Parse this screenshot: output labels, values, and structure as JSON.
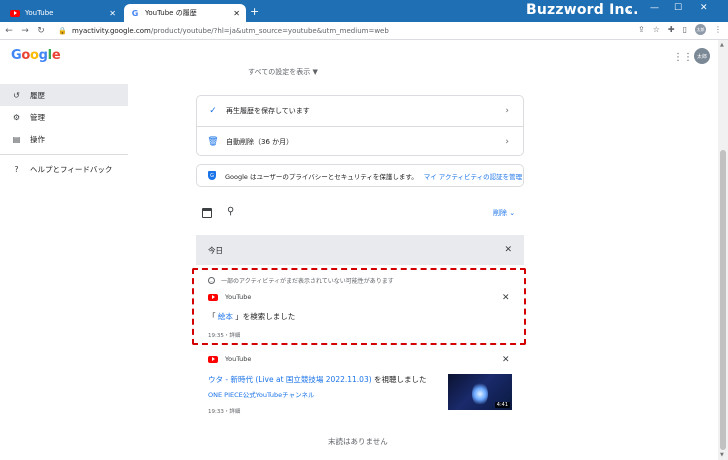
{
  "browser": {
    "tabs": [
      {
        "title": "YouTube",
        "active": false
      },
      {
        "title": "YouTube の履歴",
        "active": true
      }
    ],
    "new_tab": "+",
    "brand": "Buzzword Inc.",
    "url_host": "myactivity.google.com",
    "url_path": "/product/youtube/?hl=ja&utm_source=youtube&utm_medium=web",
    "profile_avatar": "太郎"
  },
  "header": {
    "logo_letters": [
      "G",
      "o",
      "o",
      "g",
      "l",
      "e"
    ],
    "account_avatar": "太郎"
  },
  "sidebar": {
    "items": [
      {
        "label": "履歴",
        "icon": "history-icon",
        "selected": true
      },
      {
        "label": "管理",
        "icon": "gear-icon",
        "selected": false
      },
      {
        "label": "操作",
        "icon": "feedback-icon",
        "selected": false
      },
      {
        "label": "ヘルプとフィードバック",
        "icon": "help-icon",
        "selected": false
      }
    ]
  },
  "main": {
    "cut_text": "すべての設定を表示 ▼",
    "settings": [
      {
        "label": "再生履歴を保存しています",
        "icon": "check-circle-icon"
      },
      {
        "label": "自動削除（36 か月）",
        "icon": "auto-delete-icon"
      }
    ],
    "privacy": {
      "text": "Google はユーザーのプライバシーとセキュリティを保護します。",
      "link": "マイ アクティビティの認証を管理",
      "shield": "G"
    },
    "delete_label": "削除 ⌄",
    "today_label": "今日",
    "notice": "一部のアクティビティがまだ表示されていない可能性があります",
    "items": [
      {
        "service": "YouTube",
        "prefix": "「",
        "link": " 絵本 ",
        "suffix": "」を検索しました",
        "meta": "19:35・詳細"
      },
      {
        "service": "YouTube",
        "link": "ウタ - 新時代 (Live at 国立競技場 2022.11.03)",
        "suffix": " を視聴しました",
        "channel": "ONE PIECE公式YouTubeチャンネル",
        "duration": "4:41",
        "meta": "19:33・詳細"
      }
    ],
    "end_text": "末読はありません"
  },
  "colors": {
    "tab_bar": "#1f6fb5",
    "link": "#1a73e8",
    "highlight_border": "#d40000",
    "youtube_red": "#ff0000"
  }
}
